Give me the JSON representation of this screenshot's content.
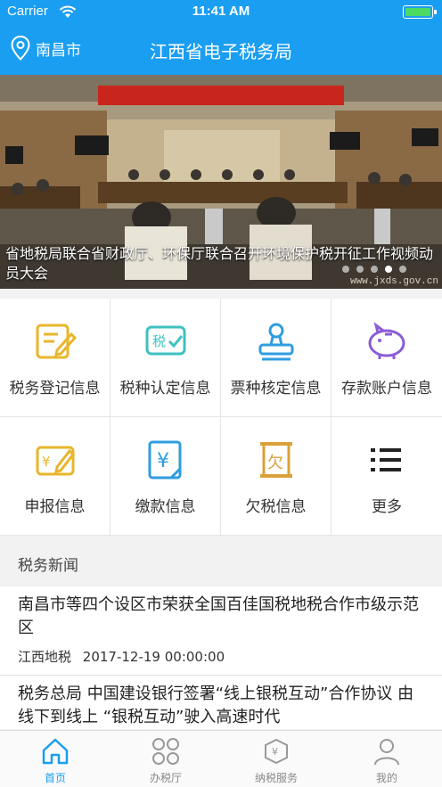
{
  "status_bar": {
    "carrier": "Carrier",
    "time": "11:41 AM",
    "battery_level": 1.0
  },
  "nav": {
    "location": "南昌市",
    "title": "江西省电子税务局",
    "location_icon": "location-pin-icon"
  },
  "banner": {
    "caption": "省地税局联合省财政厅、环保厅联合召开环境保护税开征工作视频动员大会",
    "sign_text": "省地税局纪念建军90周年复转军人座谈会",
    "watermark": "www.jxds.gov.cn",
    "slide_count": 5,
    "active_slide": 3
  },
  "grid": [
    {
      "label": "税务登记信息",
      "icon": "registration-doc-icon",
      "color": "#e8b62b"
    },
    {
      "label": "税种认定信息",
      "icon": "tax-check-icon",
      "color": "#3fc1c0"
    },
    {
      "label": "票种核定信息",
      "icon": "stamp-icon",
      "color": "#2f9de0"
    },
    {
      "label": "存款账户信息",
      "icon": "piggy-bank-icon",
      "color": "#8b5cd6"
    },
    {
      "label": "申报信息",
      "icon": "declare-icon",
      "color": "#e8b62b"
    },
    {
      "label": "缴款信息",
      "icon": "payment-yen-icon",
      "color": "#2f9de0"
    },
    {
      "label": "欠税信息",
      "icon": "arrears-scroll-icon",
      "color": "#d9a13a"
    },
    {
      "label": "更多",
      "icon": "more-list-icon",
      "color": "#222222"
    }
  ],
  "news": {
    "header": "税务新闻",
    "items": [
      {
        "title": "南昌市等四个设区市荣获全国百佳国税地税合作市级示范区",
        "source": "江西地税",
        "date": "2017-12-19 00:00:00"
      },
      {
        "title": "税务总局 中国建设银行签署“线上银税互动”合作协议 由线下到线上 “银税互动”驶入高速时代",
        "source": "",
        "date": ""
      }
    ]
  },
  "tabbar": [
    {
      "label": "首页",
      "icon": "home-icon",
      "active": true
    },
    {
      "label": "办税厅",
      "icon": "grid-circles-icon",
      "active": false
    },
    {
      "label": "纳税服务",
      "icon": "tax-service-icon",
      "active": false
    },
    {
      "label": "我的",
      "icon": "user-icon",
      "active": false
    }
  ],
  "colors": {
    "brand": "#1a9ef1",
    "active_tab": "#1a9ef1",
    "inactive_tab": "#888888"
  }
}
